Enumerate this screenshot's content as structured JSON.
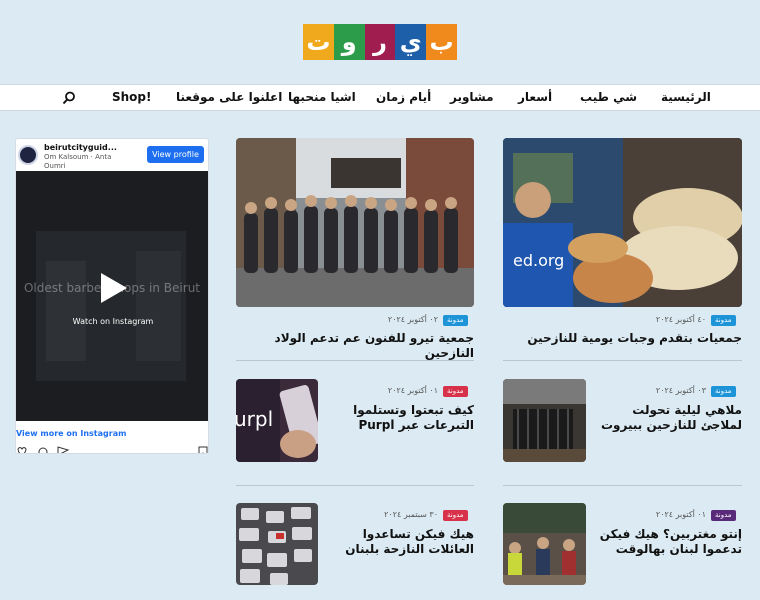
{
  "site": {
    "logo_letters": [
      "ب",
      "ي",
      "ر",
      "و",
      "ت"
    ],
    "logo_colors": [
      "#f08a1c",
      "#1d5fa8",
      "#a01e4f",
      "#2c9c4a",
      "#f0a81c"
    ]
  },
  "nav": {
    "items": [
      "الرئيسية",
      "شي طيب",
      "أسعار",
      "مشاوير",
      "أيام زمان",
      "اشيا منحبها",
      "اعلنوا على موقعنا",
      "Shop!"
    ],
    "search_icon": "search-icon"
  },
  "articles": [
    {
      "badge": "مدونة",
      "badge_color": "#1d93d8",
      "date": "٤٠ أكتوبر ٢٠٢٤",
      "title": "جمعيات بتقدم وجبات يومية للنازحين"
    },
    {
      "badge": "مدونة",
      "badge_color": "#1d93d8",
      "date": "٠٢ أكتوبر ٢٠٢٤",
      "title": "جمعية تيرو للفنون عم تدعم الولاد النازحين"
    },
    {
      "badge": "مدونة",
      "badge_color": "#1d93d8",
      "date": "٠٣ أكتوبر ٢٠٢٤",
      "title": "ملاهي ليلية تحولت لملاجئ للنازحين ببيروت"
    },
    {
      "badge": "مدونة",
      "badge_color": "#d8324a",
      "date": "٠١ أكتوبر ٢٠٢٤",
      "title": "كيف تبعتوا وتستلموا التبرعات عبر Purpl"
    },
    {
      "badge": "مدونة",
      "badge_color": "#5a2a7a",
      "date": "٠١ أكتوبر ٢٠٢٤",
      "title": "إنتو مغتربين؟ هيك فيكن تدعموا لبنان بهالوقت"
    },
    {
      "badge": "مدونة",
      "badge_color": "#d8324a",
      "date": "٣٠ سبتمبر ٢٠٢٤",
      "title": "هيك فيكن تساعدوا العائلات النازحة بلبنان"
    }
  ],
  "instagram": {
    "username": "beirutcityguid...",
    "subtitle": "Om Kalsoum · Anta Oumri",
    "view_profile": "View profile",
    "watch_label": "Watch on Instagram",
    "overlay_text": "Oldest barber shops in Beirut",
    "view_more": "View more on Instagram"
  }
}
